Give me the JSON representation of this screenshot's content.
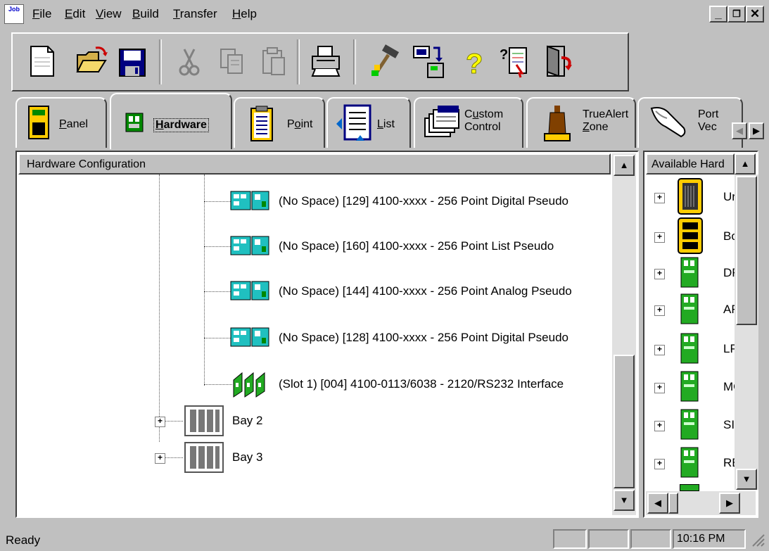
{
  "app": {
    "icon_text": "Job"
  },
  "menu": {
    "items": [
      {
        "label": "File",
        "ul": "F",
        "rest": "ile"
      },
      {
        "label": "Edit",
        "ul": "E",
        "rest": "dit"
      },
      {
        "label": "View",
        "ul": "V",
        "rest": "iew"
      },
      {
        "label": "Build",
        "ul": "B",
        "rest": "uild"
      },
      {
        "label": "Transfer",
        "ul": "T",
        "rest": "ransfer"
      },
      {
        "label": "Help",
        "ul": "H",
        "rest": "elp"
      }
    ]
  },
  "window_controls": {
    "minimize": "_",
    "restore": "❐",
    "close": "✕"
  },
  "toolbar": {
    "buttons": [
      "new-document-icon",
      "open-folder-icon",
      "save-disk-icon",
      "cut-scissors-icon",
      "copy-icon",
      "paste-icon",
      "print-icon",
      "build-hammer-icon",
      "transfer-icon",
      "help-question-icon",
      "context-help-icon",
      "exit-door-icon"
    ]
  },
  "tabs": [
    {
      "label": "Panel",
      "ul": "P",
      "rest": "anel"
    },
    {
      "label": "Hardware",
      "ul": "H",
      "rest": "ardware"
    },
    {
      "label": "Point",
      "pre": "P",
      "ul": "o",
      "rest": "int"
    },
    {
      "label": "List",
      "ul": "L",
      "rest": "ist"
    },
    {
      "label": "Custom Control",
      "line1_pre": "C",
      "line1_ul": "u",
      "line1_rest": "stom",
      "line2": "Control"
    },
    {
      "label": "TrueAlert Zone",
      "line1": "TrueAlert",
      "line2_ul": "Z",
      "line2_rest": "one"
    },
    {
      "label": "Port Vec",
      "line1": "Port",
      "line2": "Vec"
    }
  ],
  "tree": {
    "header": "Hardware Configuration",
    "nodes": [
      {
        "label": "(No Space) [129] 4100-xxxx - 256 Point Digital Pseudo",
        "icon": "pseudo-card-icon"
      },
      {
        "label": "(No Space) [160] 4100-xxxx - 256 Point List Pseudo",
        "icon": "pseudo-card-icon"
      },
      {
        "label": "(No Space) [144] 4100-xxxx - 256 Point Analog Pseudo",
        "icon": "pseudo-card-icon"
      },
      {
        "label": "(No Space) [128] 4100-xxxx - 256 Point Digital Pseudo",
        "icon": "pseudo-card-icon"
      },
      {
        "label": "(Slot 1) [004] 4100-0113/6038 - 2120/RS232 Interface",
        "icon": "interface-card-icon"
      }
    ],
    "bays": [
      {
        "label": "Bay 2",
        "expander": "+"
      },
      {
        "label": "Bay 3",
        "expander": "+"
      }
    ]
  },
  "available": {
    "header": "Available Hard",
    "items": [
      {
        "label": "Ur",
        "expander": "+",
        "icon": "panel-unit-icon"
      },
      {
        "label": "Bo",
        "expander": "+",
        "icon": "box-icon"
      },
      {
        "label": "DF",
        "expander": "+",
        "icon": "card-icon"
      },
      {
        "label": "AF",
        "expander": "+",
        "icon": "card-icon"
      },
      {
        "label": "LP",
        "expander": "+",
        "icon": "card-icon"
      },
      {
        "label": "MC",
        "expander": "+",
        "icon": "card-icon"
      },
      {
        "label": "SI(",
        "expander": "+",
        "icon": "card-icon"
      },
      {
        "label": "RE",
        "expander": "+",
        "icon": "card-icon"
      }
    ]
  },
  "status": {
    "text": "Ready",
    "time": "10:16 PM"
  }
}
